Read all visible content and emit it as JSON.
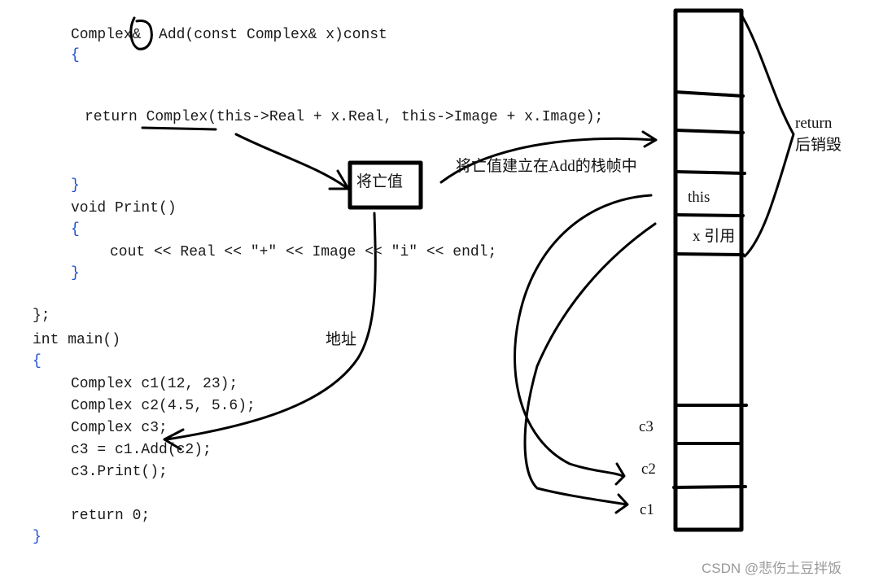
{
  "code_lines": [
    "Complex&  Add(const Complex& x)const",
    "{",
    "return Complex(this->Real + x.Real, this->Image + x.Image);",
    "}",
    "void Print()",
    "{",
    "cout << Real << \"+\" << Image << \"i\" << endl;",
    "}",
    "};",
    "int main()",
    "{",
    "Complex c1(12, 23);",
    "Complex c2(4.5, 5.6);",
    "Complex c3;",
    "c3 = c1.Add(c2);",
    "c3.Print();",
    "return 0;",
    "}"
  ],
  "annotations": {
    "xvalue_box": "将亡值",
    "xvalue_caption": "将亡值建立在Add的栈帧中",
    "address": "地址",
    "return_note_1": "return",
    "return_note_2": "后销毁"
  },
  "stack": {
    "slots": [
      "this",
      "x 引用",
      "c3",
      "c2",
      "c1"
    ]
  },
  "watermark": "CSDN @悲伤土豆拌饭"
}
